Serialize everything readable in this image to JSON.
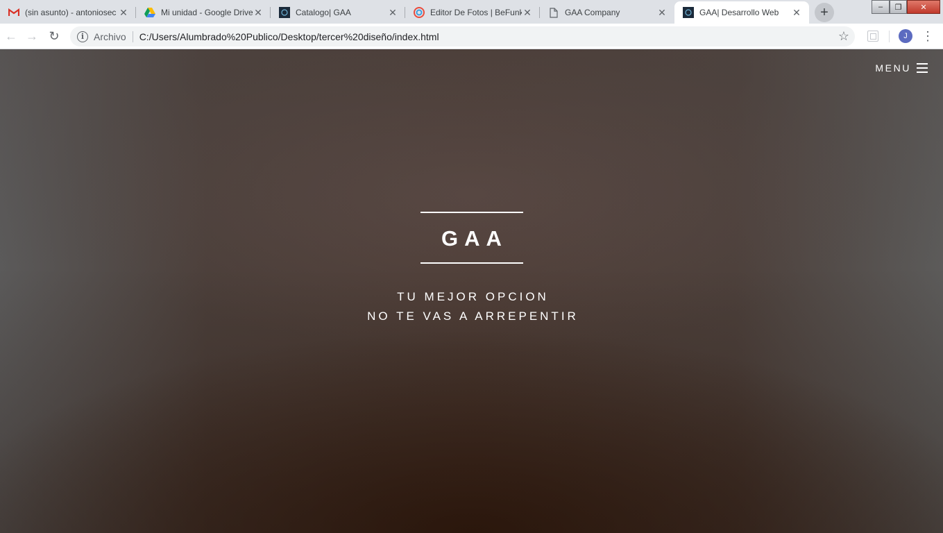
{
  "browser": {
    "tabs": [
      {
        "title": "(sin asunto) - antoniosec",
        "favicon": "gmail-icon"
      },
      {
        "title": "Mi unidad - Google Drive",
        "favicon": "google-drive-icon"
      },
      {
        "title": "Catalogo| GAA",
        "favicon": "gaa-site-icon"
      },
      {
        "title": "Editor De Fotos | BeFunky",
        "favicon": "befunky-icon"
      },
      {
        "title": "GAA Company",
        "favicon": "document-icon"
      },
      {
        "title": "GAA| Desarrollo Web",
        "favicon": "gaa-site-icon",
        "active": true
      }
    ],
    "close_glyph": "✕",
    "new_tab_glyph": "+",
    "omnibox": {
      "info_glyph": "i",
      "chip": "Archivo",
      "url": "C:/Users/Alumbrado%20Publico/Desktop/tercer%20diseño/index.html"
    },
    "nav": {
      "back": "←",
      "forward": "→",
      "reload": "↻",
      "star": "☆",
      "menu": "⋮"
    },
    "profile_initial": "J",
    "window_controls": {
      "minimize": "–",
      "maximize": "❐",
      "close": "✕"
    }
  },
  "page": {
    "menu_label": "MENU",
    "brand": "GAA",
    "tagline_line1": "TU MEJOR OPCION",
    "tagline_line2": "NO TE VAS A ARREPENTIR"
  },
  "colors": {
    "gmail_red": "#d93025",
    "avatar": "#5c6bc0",
    "text_on_hero": "#ffffff"
  }
}
